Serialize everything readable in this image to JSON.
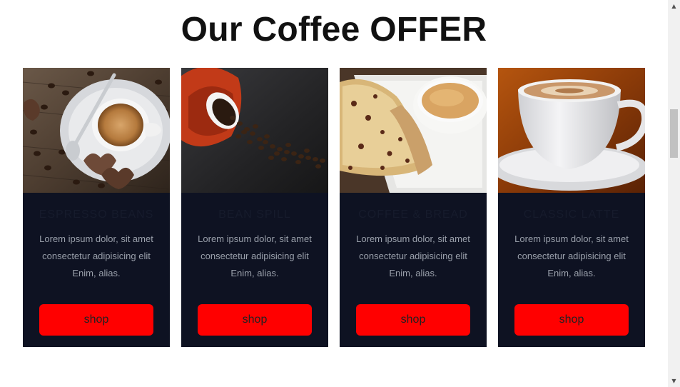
{
  "page": {
    "title": "Our Coffee OFFER"
  },
  "cards": [
    {
      "title": "ESPRESSO BEANS",
      "description": "Lorem ipsum dolor, sit amet consectetur adipisicing elit Enim, alias.",
      "button": "shop"
    },
    {
      "title": "BEAN SPILL",
      "description": "Lorem ipsum dolor, sit amet consectetur adipisicing elit Enim, alias.",
      "button": "shop"
    },
    {
      "title": "COFFEE & BREAD",
      "description": "Lorem ipsum dolor, sit amet consectetur adipisicing elit Enim, alias.",
      "button": "shop"
    },
    {
      "title": "CLASSIC LATTE",
      "description": "Lorem ipsum dolor, sit amet consectetur adipisicing elit Enim, alias.",
      "button": "shop"
    }
  ],
  "scrollbar": {
    "up_icon": "▲",
    "down_icon": "▼"
  },
  "colors": {
    "card_bg": "#0e1222",
    "button_bg": "#ff0000",
    "title": "#111111"
  }
}
